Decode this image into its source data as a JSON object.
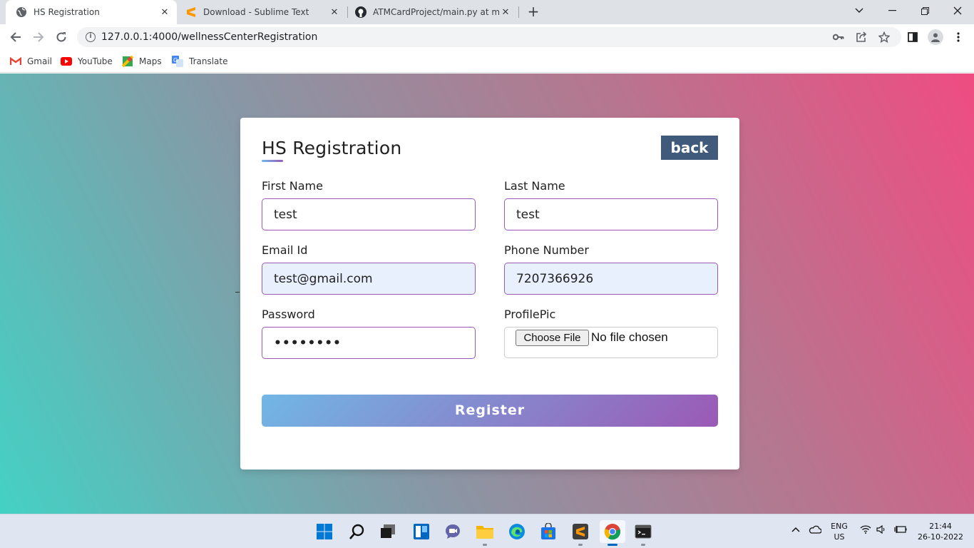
{
  "browser": {
    "tabs": [
      {
        "title": "HS Registration",
        "icon": "globe-icon",
        "active": true
      },
      {
        "title": "Download - Sublime Text",
        "icon": "sublime-icon",
        "active": false
      },
      {
        "title": "ATMCardProject/main.py at main",
        "icon": "github-icon",
        "active": false
      }
    ],
    "new_tab": "+",
    "window_controls": {
      "chevron": "⌄",
      "minimize": "—",
      "restore": "❐",
      "close": "✕"
    },
    "url": "127.0.0.1:4000/wellnessCenterRegistration",
    "bookmarks": [
      {
        "label": "Gmail",
        "icon": "gmail-icon",
        "color": "#EA4335"
      },
      {
        "label": "YouTube",
        "icon": "youtube-icon",
        "color": "#FF0000"
      },
      {
        "label": "Maps",
        "icon": "maps-icon",
        "color": "#34A853"
      },
      {
        "label": "Translate",
        "icon": "translate-icon",
        "color": "#4285F4"
      }
    ]
  },
  "form": {
    "title": "HS Registration",
    "back_label": "back",
    "fields": {
      "first_name": {
        "label": "First Name",
        "value": "test"
      },
      "last_name": {
        "label": "Last Name",
        "value": "test"
      },
      "email": {
        "label": "Email Id",
        "value": "test@gmail.com"
      },
      "phone": {
        "label": "Phone Number",
        "value": "7207366926"
      },
      "password": {
        "label": "Password",
        "value": "••••••••"
      },
      "profile_pic": {
        "label": "ProfilePic",
        "button": "Choose File",
        "status": "No file chosen"
      }
    },
    "submit_label": "Register",
    "colors": {
      "accent_start": "#71b7e6",
      "accent_end": "#9b59b6",
      "back_button": "#3f5a7a"
    }
  },
  "taskbar": {
    "apps": [
      "windows-start-icon",
      "search-icon",
      "task-view-icon",
      "widgets-icon",
      "teams-chat-icon",
      "file-explorer-icon",
      "edge-icon",
      "store-icon",
      "sublime-icon",
      "chrome-icon",
      "terminal-icon"
    ],
    "language": {
      "line1": "ENG",
      "line2": "US"
    },
    "time": "21:44",
    "date": "26-10-2022"
  }
}
